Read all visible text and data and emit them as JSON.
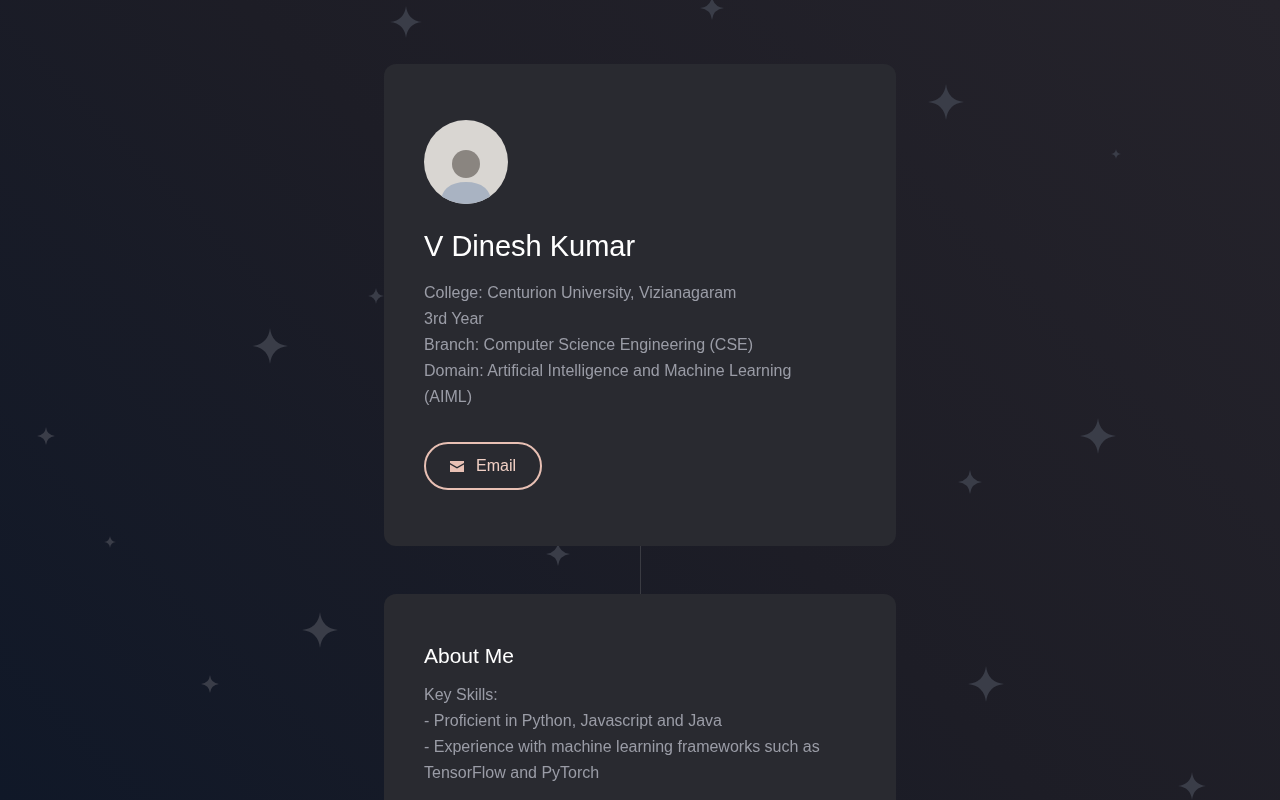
{
  "profile": {
    "name": "V Dinesh Kumar",
    "details": [
      "College: Centurion University, Vizianagaram",
      "3rd Year",
      "Branch: Computer Science Engineering (CSE)",
      "Domain: Artificial Intelligence and Machine Learning (AIML)"
    ],
    "button": {
      "label": "Email"
    }
  },
  "about": {
    "title": "About Me",
    "lines": [
      "Key Skills:",
      "- Proficient in Python, Javascript and Java",
      "- Experience with machine learning frameworks such as TensorFlow and PyTorch"
    ]
  }
}
